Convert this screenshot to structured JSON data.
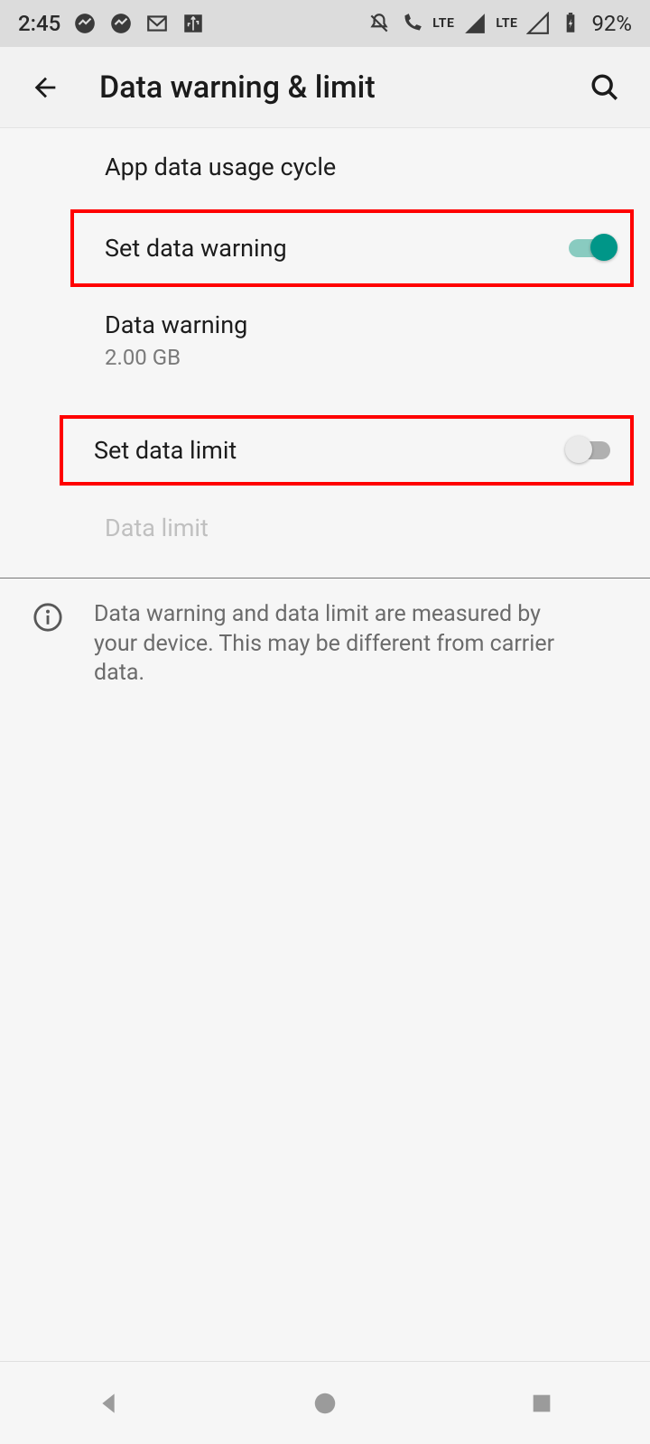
{
  "statusbar": {
    "time": "2:45",
    "battery_pct": "92%",
    "network_label_1": "LTE",
    "network_label_2": "LTE"
  },
  "appbar": {
    "title": "Data warning & limit"
  },
  "rows": {
    "cycle": {
      "primary": "App data usage cycle"
    },
    "set_warning": {
      "primary": "Set data warning",
      "toggle_on": true
    },
    "data_warning": {
      "primary": "Data warning",
      "secondary": "2.00 GB"
    },
    "set_limit": {
      "primary": "Set data limit",
      "toggle_on": false
    },
    "data_limit": {
      "primary": "Data limit"
    }
  },
  "info": {
    "text": "Data warning and data limit are measured by your device. This may be different from carrier data."
  },
  "highlight_color": "#ff0000",
  "accent_color": "#009688"
}
